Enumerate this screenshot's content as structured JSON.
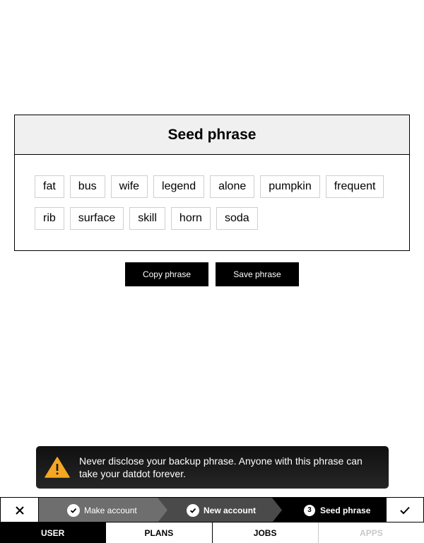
{
  "seed_card": {
    "title": "Seed phrase",
    "words": [
      "fat",
      "bus",
      "wife",
      "legend",
      "alone",
      "pumpkin",
      "frequent",
      "rib",
      "surface",
      "skill",
      "horn",
      "soda"
    ]
  },
  "actions": {
    "copy_label": "Copy phrase",
    "save_label": "Save phrase"
  },
  "toast": {
    "icon": "warning-icon",
    "message": "Never disclose your backup phrase. Anyone with this phrase can take your datdot forever.",
    "icon_color": "#f5a623"
  },
  "stepper": {
    "close_icon": "close-icon",
    "confirm_icon": "checkmark-icon",
    "steps": [
      {
        "label": "Make account",
        "status": "completed",
        "icon": "check-circle-icon"
      },
      {
        "label": "New account",
        "status": "completed",
        "icon": "check-circle-icon"
      },
      {
        "label": "Seed phrase",
        "status": "current",
        "number": "3"
      }
    ]
  },
  "tabs": [
    {
      "label": "USER",
      "state": "active"
    },
    {
      "label": "PLANS",
      "state": "normal"
    },
    {
      "label": "JOBS",
      "state": "normal"
    },
    {
      "label": "APPS",
      "state": "disabled"
    }
  ]
}
